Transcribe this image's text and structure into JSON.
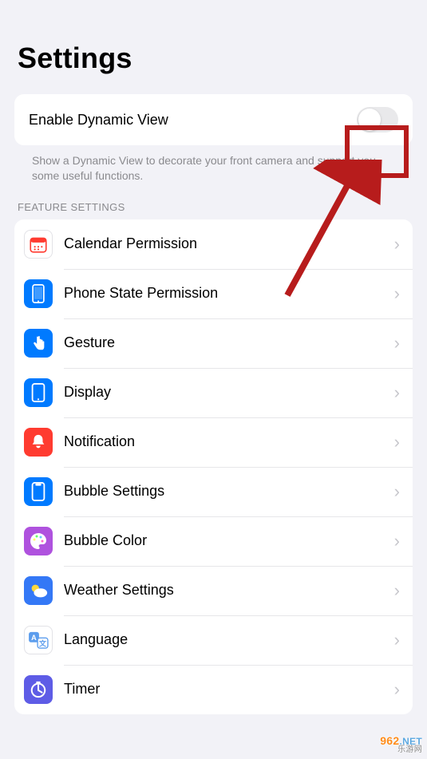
{
  "title": "Settings",
  "enable_dynamic": {
    "label": "Enable Dynamic View",
    "description": "Show a Dynamic View to decorate your front camera and support you some useful functions."
  },
  "feature_settings_header": "FEATURE SETTINGS",
  "items": [
    {
      "label": "Calendar Permission",
      "icon": "calendar",
      "bg": "#ffffff",
      "fg": "#ff3b30",
      "border": true
    },
    {
      "label": "Phone State Permission",
      "icon": "phone",
      "bg": "#007aff",
      "fg": "#ffffff"
    },
    {
      "label": "Gesture",
      "icon": "gesture",
      "bg": "#007aff",
      "fg": "#ffffff"
    },
    {
      "label": "Display",
      "icon": "display",
      "bg": "#007aff",
      "fg": "#ffffff"
    },
    {
      "label": "Notification",
      "icon": "bell",
      "bg": "#ff3b30",
      "fg": "#ffffff"
    },
    {
      "label": "Bubble Settings",
      "icon": "bubble",
      "bg": "#007aff",
      "fg": "#ffffff"
    },
    {
      "label": "Bubble Color",
      "icon": "palette",
      "bg": "#af52de",
      "fg": "#ffffff"
    },
    {
      "label": "Weather Settings",
      "icon": "weather",
      "bg": "#3478f6",
      "fg": "#ffffff"
    },
    {
      "label": "Language",
      "icon": "language",
      "bg": "#ffffff",
      "fg": "#5c9ded",
      "border": true
    },
    {
      "label": "Timer",
      "icon": "timer",
      "bg": "#5e5ce6",
      "fg": "#ffffff"
    }
  ],
  "watermark": {
    "main": "962",
    "net": ".NET",
    "sub": "乐游网"
  }
}
